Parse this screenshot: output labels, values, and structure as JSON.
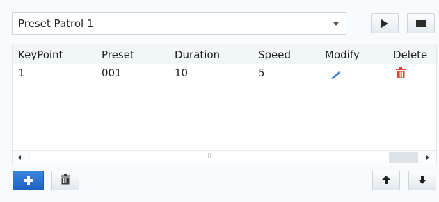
{
  "patrol_select": {
    "value": "Preset Patrol 1"
  },
  "table": {
    "columns": [
      "KeyPoint",
      "Preset",
      "Duration",
      "Speed",
      "Modify",
      "Delete"
    ],
    "rows": [
      {
        "keypoint": "1",
        "preset": "001",
        "duration": "10",
        "speed": "5",
        "modify_icon": "pencil-icon",
        "delete_icon": "trash-icon"
      }
    ]
  },
  "toolbar": {
    "play_icon": "play-icon",
    "stop_icon": "stop-icon",
    "add_icon": "plus-icon",
    "delete_icon": "trash-icon",
    "move_up_icon": "arrow-up-icon",
    "move_down_icon": "arrow-down-icon"
  },
  "colors": {
    "accent_blue": "#2a73d2",
    "delete_red": "#d9432f",
    "edit_blue": "#3b7fd6"
  }
}
